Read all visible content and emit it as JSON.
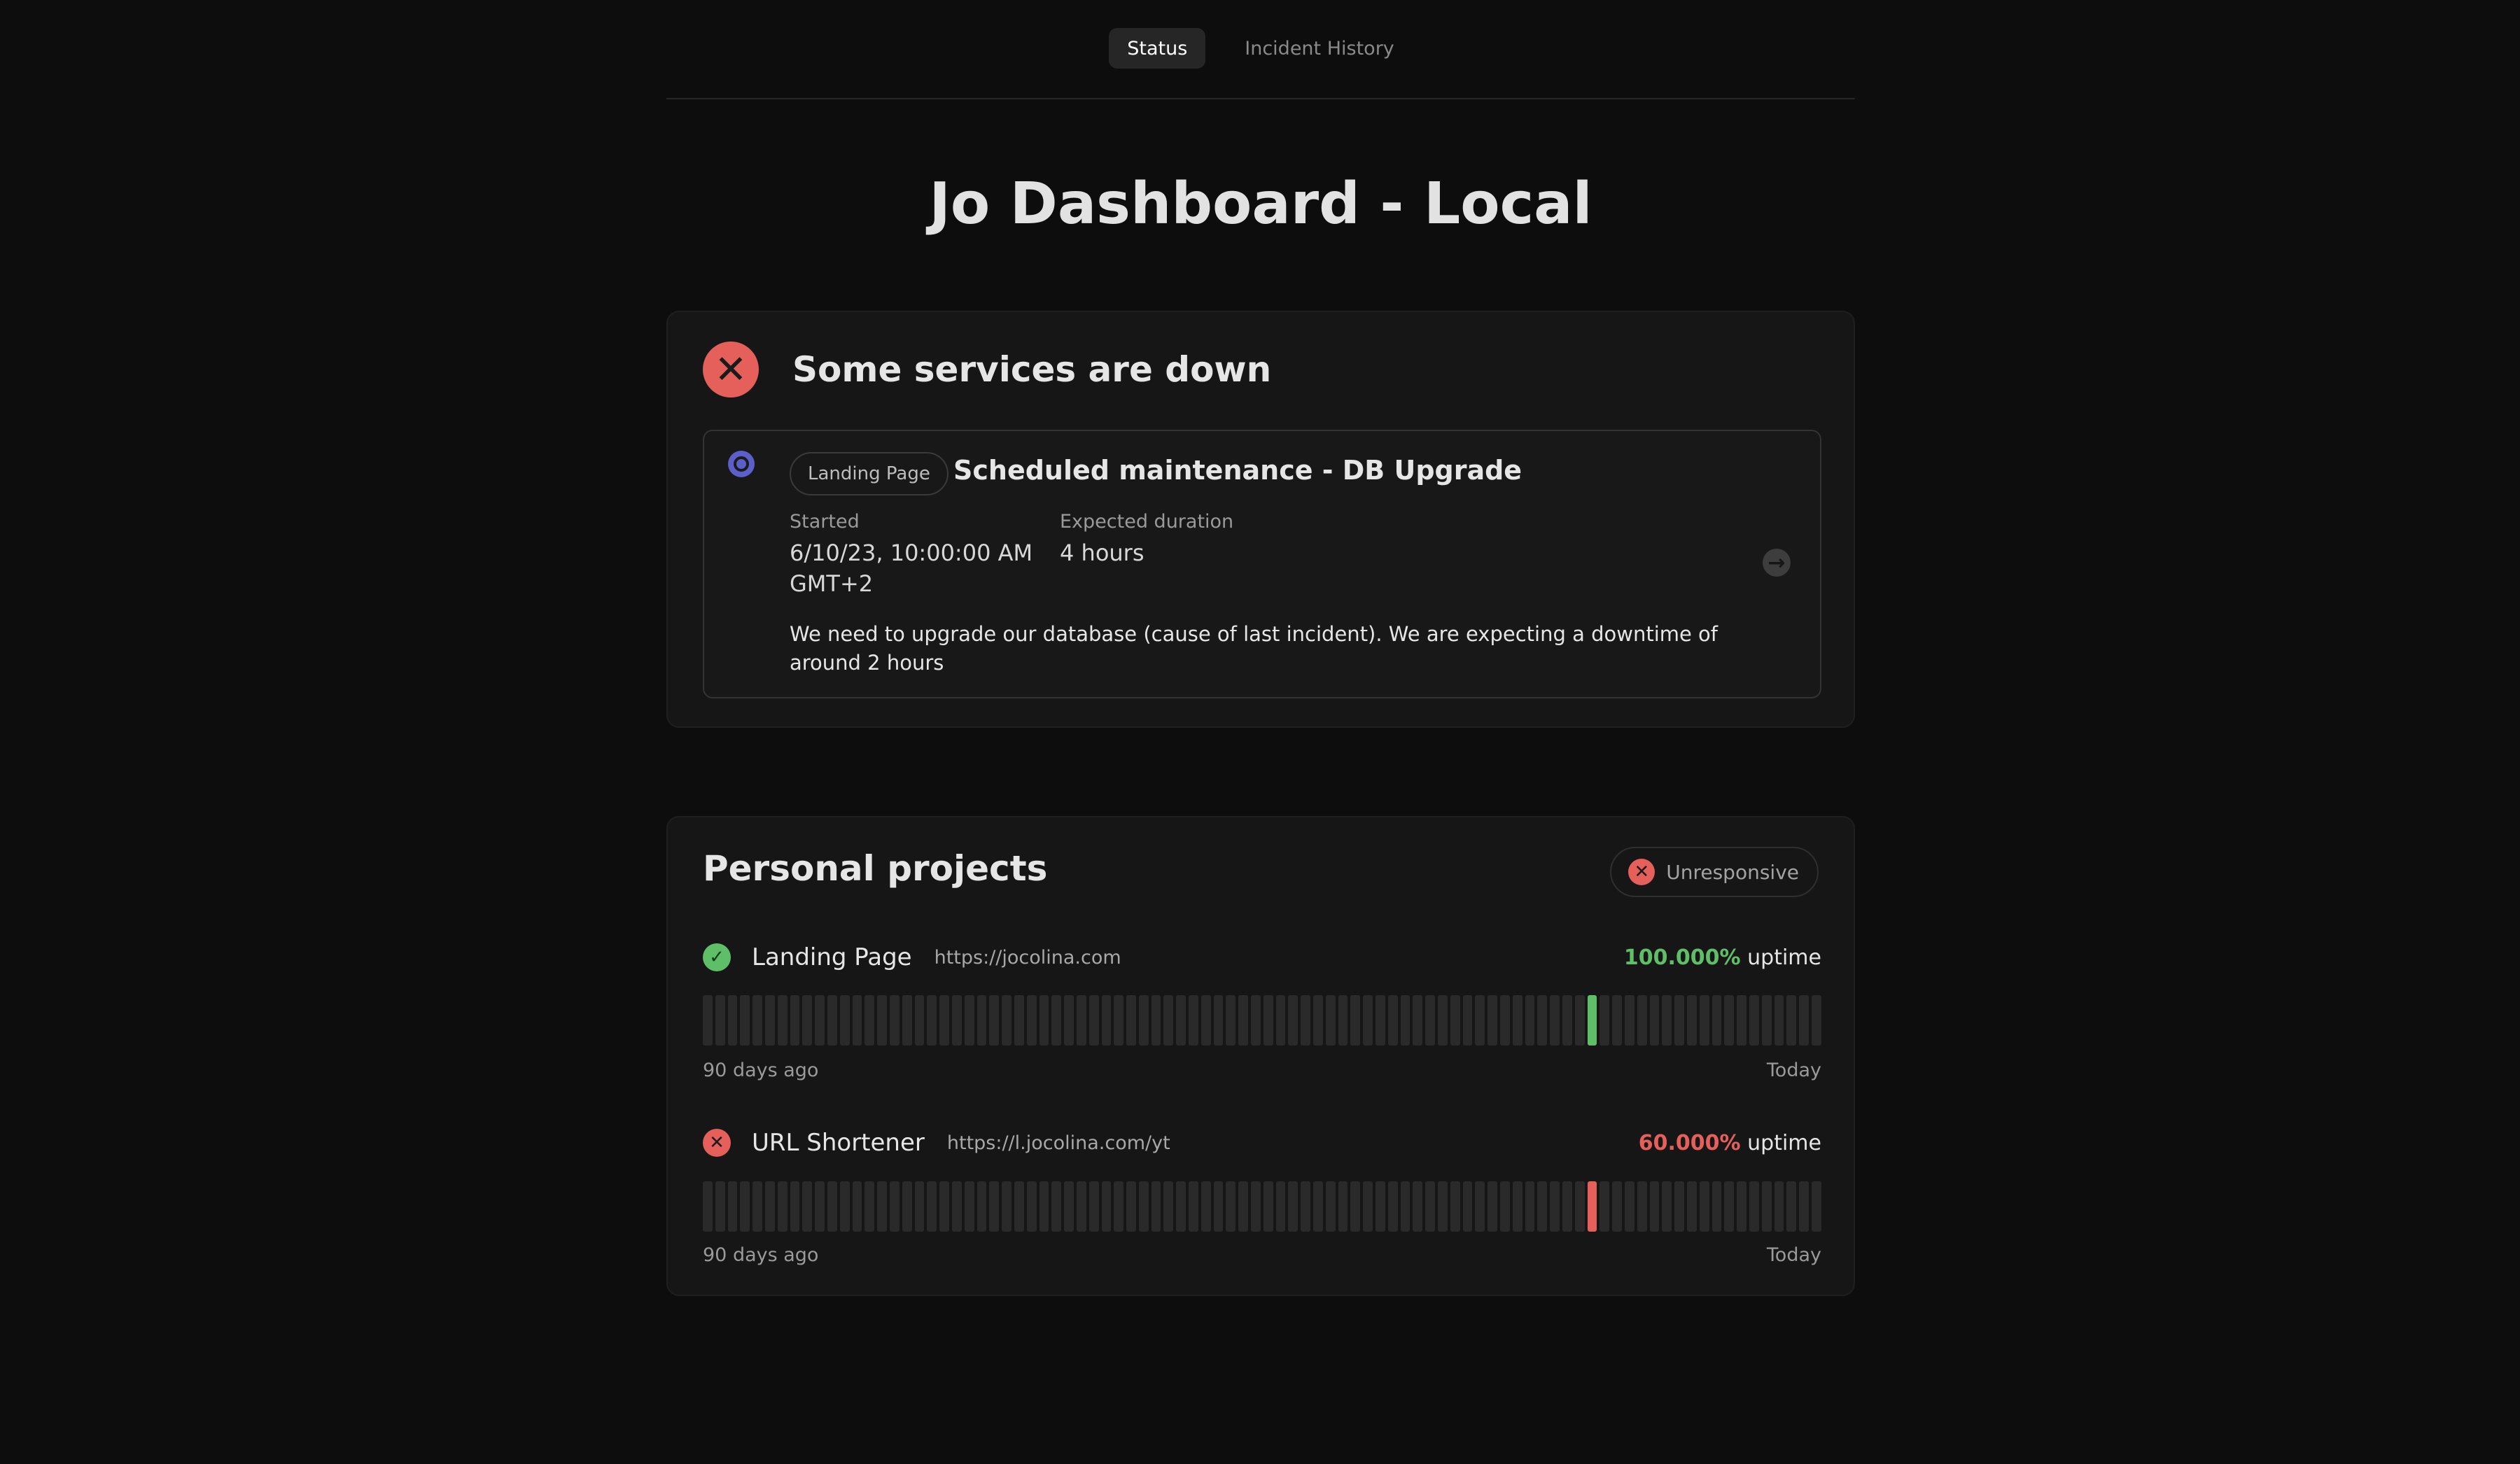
{
  "nav": {
    "tabs": [
      {
        "label": "Status",
        "active": true
      },
      {
        "label": "Incident History",
        "active": false
      }
    ]
  },
  "page_title": "Jo Dashboard - Local",
  "status": {
    "title": "Some services are down",
    "icon": "x-circle-icon",
    "color": "#e5605b"
  },
  "incident": {
    "tag": "Landing Page",
    "title": "Scheduled maintenance - DB Upgrade",
    "started_label": "Started",
    "started_value": "6/10/23, 10:00:00 AM GMT+2",
    "duration_label": "Expected duration",
    "duration_value": "4 hours",
    "description": "We need to upgrade our database (cause of last incident). We are expecting a downtime of around 2 hours",
    "status_color": "#5b5fc7"
  },
  "projects": {
    "title": "Personal projects",
    "badge_label": "Unresponsive",
    "range_start_label": "90 days ago",
    "range_end_label": "Today",
    "uptime_suffix": "uptime",
    "colors": {
      "up": "#5fbf69",
      "down": "#e5605b",
      "empty": "#2a2a2a"
    },
    "bar_count": 90,
    "services": [
      {
        "name": "Landing Page",
        "url": "https://jocolina.com",
        "uptime_pct": "100.000%",
        "status": "up",
        "highlight_day_index": 71
      },
      {
        "name": "URL Shortener",
        "url": "https://l.jocolina.com/yt",
        "uptime_pct": "60.000%",
        "status": "down",
        "highlight_day_index": 71
      }
    ]
  }
}
